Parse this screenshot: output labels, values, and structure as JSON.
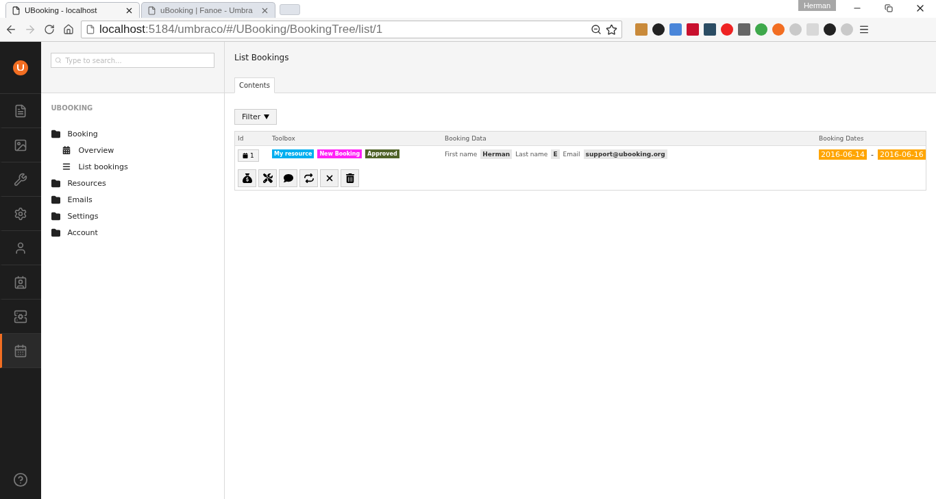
{
  "browser": {
    "tabs": [
      {
        "title": "UBooking - localhost",
        "selected": true
      },
      {
        "title": "uBooking | Fanoe - Umbra",
        "selected": false
      }
    ],
    "profile": "Herman",
    "address": {
      "host": "localhost",
      "path": ":5184/umbraco/#/UBooking/BookingTree/list/1"
    }
  },
  "sections": [
    {
      "kind": "content",
      "selected": false
    },
    {
      "kind": "media",
      "selected": false
    },
    {
      "kind": "developer",
      "selected": false
    },
    {
      "kind": "settings",
      "selected": false
    },
    {
      "kind": "users",
      "selected": false
    },
    {
      "kind": "members",
      "selected": false
    },
    {
      "kind": "forms",
      "selected": false
    },
    {
      "kind": "booking",
      "selected": true
    }
  ],
  "tree": {
    "search": {
      "placeholder": "Type to search..."
    },
    "heading": "UBOOKING",
    "items": [
      {
        "label": "Booking",
        "kind": "folder",
        "children": [
          {
            "label": "Overview",
            "kind": "calendar"
          },
          {
            "label": "List bookings",
            "kind": "list"
          }
        ]
      },
      {
        "label": "Resources",
        "kind": "folder"
      },
      {
        "label": "Emails",
        "kind": "folder"
      },
      {
        "label": "Settings",
        "kind": "folder"
      },
      {
        "label": "Account",
        "kind": "folder"
      }
    ]
  },
  "main": {
    "title": "List Bookings",
    "tabs": [
      {
        "label": "Contents",
        "selected": true
      }
    ],
    "filter": "Filter",
    "table": {
      "columns": [
        "Id",
        "Toolbox",
        "Booking Data",
        "Booking Dates"
      ],
      "rows": [
        {
          "id": "1",
          "tags": [
            {
              "label": "My resource",
              "color": "#00aeef"
            },
            {
              "label": "New Booking",
              "color": "#ff21f6"
            },
            {
              "label": "Approved",
              "color": "#4f6228"
            }
          ],
          "fields": [
            {
              "label": "First name",
              "value": "Herman"
            },
            {
              "label": "Last name",
              "value": "E"
            },
            {
              "label": "Email",
              "value": "support@ubooking.org"
            }
          ],
          "dates": {
            "from": "2016-06-14",
            "separator": "-",
            "to": "2016-06-16"
          },
          "actions": [
            {
              "kind": "payment"
            },
            {
              "kind": "service"
            },
            {
              "kind": "comment"
            },
            {
              "kind": "transfer"
            },
            {
              "kind": "cancel"
            },
            {
              "kind": "delete"
            }
          ]
        }
      ]
    }
  }
}
